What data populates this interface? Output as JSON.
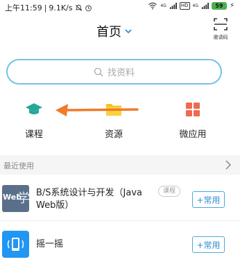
{
  "status_bar": {
    "time": "上午11:59",
    "speed": "9.1K/s",
    "network_1": "4G",
    "hd": "HD",
    "network_2": "4G",
    "battery": "59"
  },
  "header": {
    "title": "首页",
    "invite_label": "邀请码"
  },
  "search": {
    "placeholder": "找资料"
  },
  "shortcuts": [
    {
      "label": "课程",
      "icon": "graduation-cap-icon",
      "color": "#26a69a"
    },
    {
      "label": "资源",
      "icon": "folder-icon",
      "color": "#f5c518"
    },
    {
      "label": "微应用",
      "icon": "grid-apps-icon",
      "color": "#f06a4f"
    }
  ],
  "arrow_color": "#f07b2a",
  "section": {
    "title": "最近使用"
  },
  "recent": [
    {
      "title_line1": "B/S系统设计与开发（Java",
      "title_line2": "Web版）",
      "tag": "课程",
      "button": "+常用",
      "thumb_text": "Web",
      "thumb_char": "学"
    },
    {
      "title_line1": "摇一摇",
      "button": "+常用"
    }
  ],
  "colors": {
    "accent": "#2d8fd0",
    "search_border": "#74c1e6"
  }
}
